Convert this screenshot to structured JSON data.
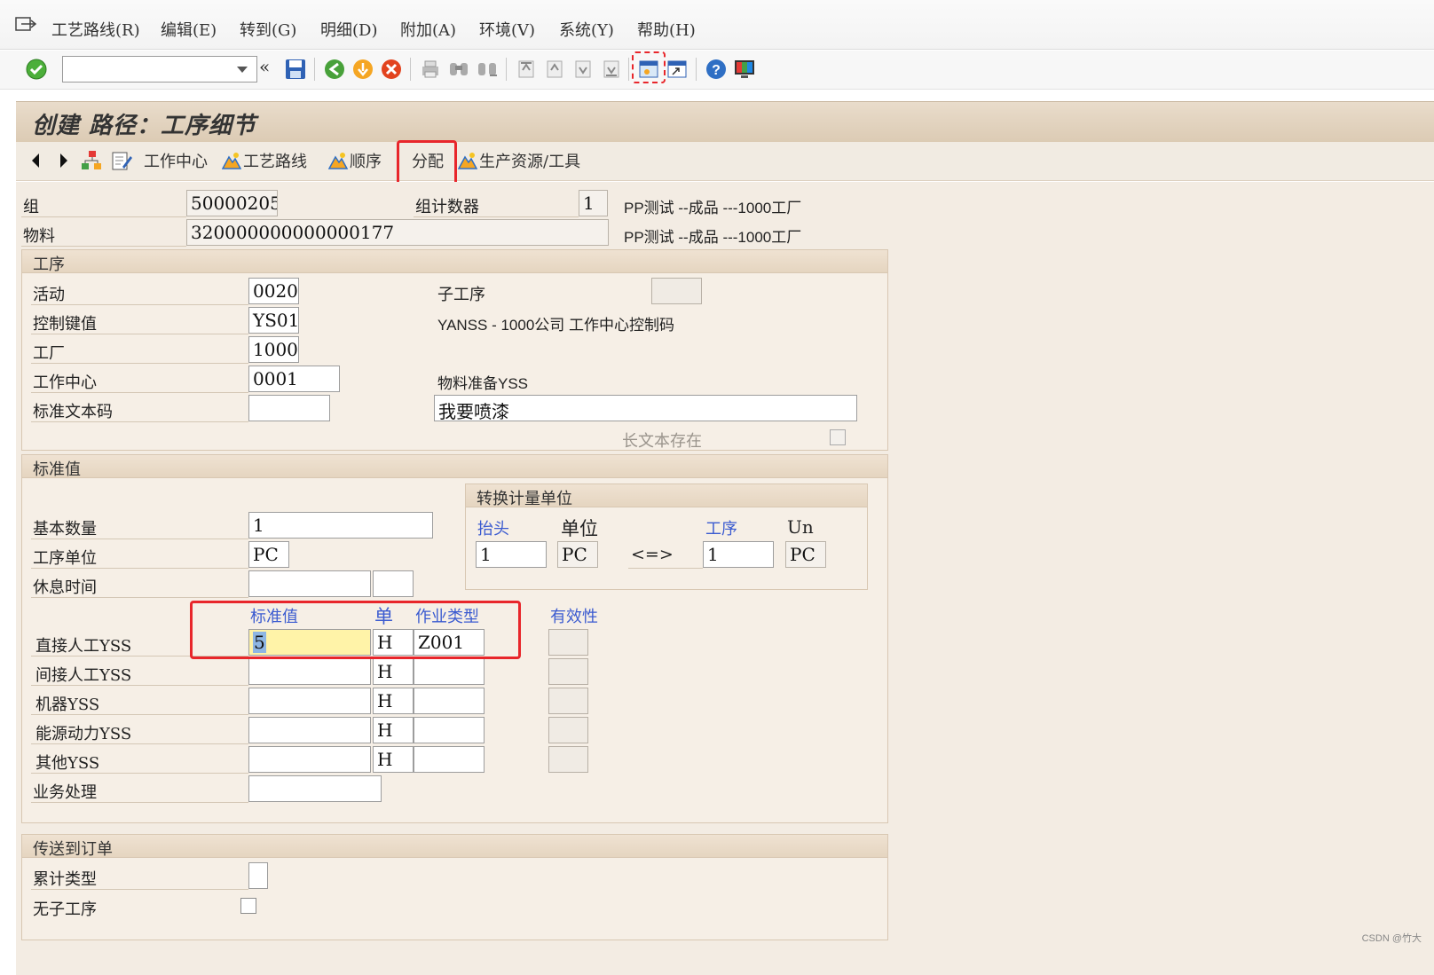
{
  "menu": {
    "items": [
      "工艺路线(R)",
      "编辑(E)",
      "转到(G)",
      "明细(D)",
      "附加(A)",
      "环境(V)",
      "系统(Y)",
      "帮助(H)"
    ]
  },
  "toolbar": {
    "command_field": "",
    "back_glyph": "«"
  },
  "title": "创建 路径：工序细节",
  "app_toolbar": {
    "work_center": "工作中心",
    "routing": "工艺路线",
    "sequence": "顺序",
    "allocation": "分配",
    "prt": "生产资源/工具"
  },
  "header": {
    "group_label": "组",
    "group_value": "50000205",
    "group_counter_label": "组计数器",
    "group_counter_value": "1",
    "group_desc": "PP测试 --成品 ---1000工厂",
    "material_label": "物料",
    "material_value": "320000000000000177",
    "material_desc": "PP测试 --成品 ---1000工厂"
  },
  "operation": {
    "section_title": "工序",
    "activity_label": "活动",
    "activity_value": "0020",
    "sub_op_label": "子工序",
    "sub_op_value": "",
    "control_key_label": "控制键值",
    "control_key_value": "YS01",
    "control_key_desc": "YANSS - 1000公司 工作中心控制码",
    "plant_label": "工厂",
    "plant_value": "1000",
    "work_center_label": "工作中心",
    "work_center_value": "0001",
    "work_center_desc": "物料准备YSS",
    "std_text_label": "标准文本码",
    "std_text_value": "",
    "op_text_value": "我要喷漆",
    "long_text_label": "长文本存在"
  },
  "standard_values": {
    "section_title": "标准值",
    "base_qty_label": "基本数量",
    "base_qty_value": "1",
    "op_unit_label": "工序单位",
    "op_unit_value": "PC",
    "break_label": "休息时间",
    "break_value": "",
    "break_unit": "",
    "conversion": {
      "title": "转换计量单位",
      "header_label": "抬头",
      "unit_label": "单位",
      "operation_label": "工序",
      "un_label": "Un",
      "header_qty": "1",
      "header_unit": "PC",
      "arrow": "<=>",
      "op_qty": "1",
      "op_unit": "PC"
    },
    "col_std_value": "标准值",
    "col_unit": "单",
    "col_activity_type": "作业类型",
    "col_validity": "有效性",
    "rows": [
      {
        "label": "直接人工YSS",
        "value": "5",
        "unit": "H",
        "activity_type": "Z001"
      },
      {
        "label": "间接人工YSS",
        "value": "",
        "unit": "H",
        "activity_type": ""
      },
      {
        "label": "机器YSS",
        "value": "",
        "unit": "H",
        "activity_type": ""
      },
      {
        "label": "能源动力YSS",
        "value": "",
        "unit": "H",
        "activity_type": ""
      },
      {
        "label": "其他YSS",
        "value": "",
        "unit": "H",
        "activity_type": ""
      }
    ],
    "business_process_label": "业务处理",
    "business_process_value": ""
  },
  "transfer": {
    "section_title": "传送到订单",
    "cumulation_label": "累计类型",
    "cumulation_value": "",
    "no_sub_op_label": "无子工序"
  },
  "watermark": "CSDN @竹大",
  "colors": {
    "background": "#f3ece3",
    "title_bar": "#dccbb4",
    "highlight_box": "#e8262b",
    "column_header_blue": "#3b5bd0",
    "selected_field": "#fff3a8"
  }
}
